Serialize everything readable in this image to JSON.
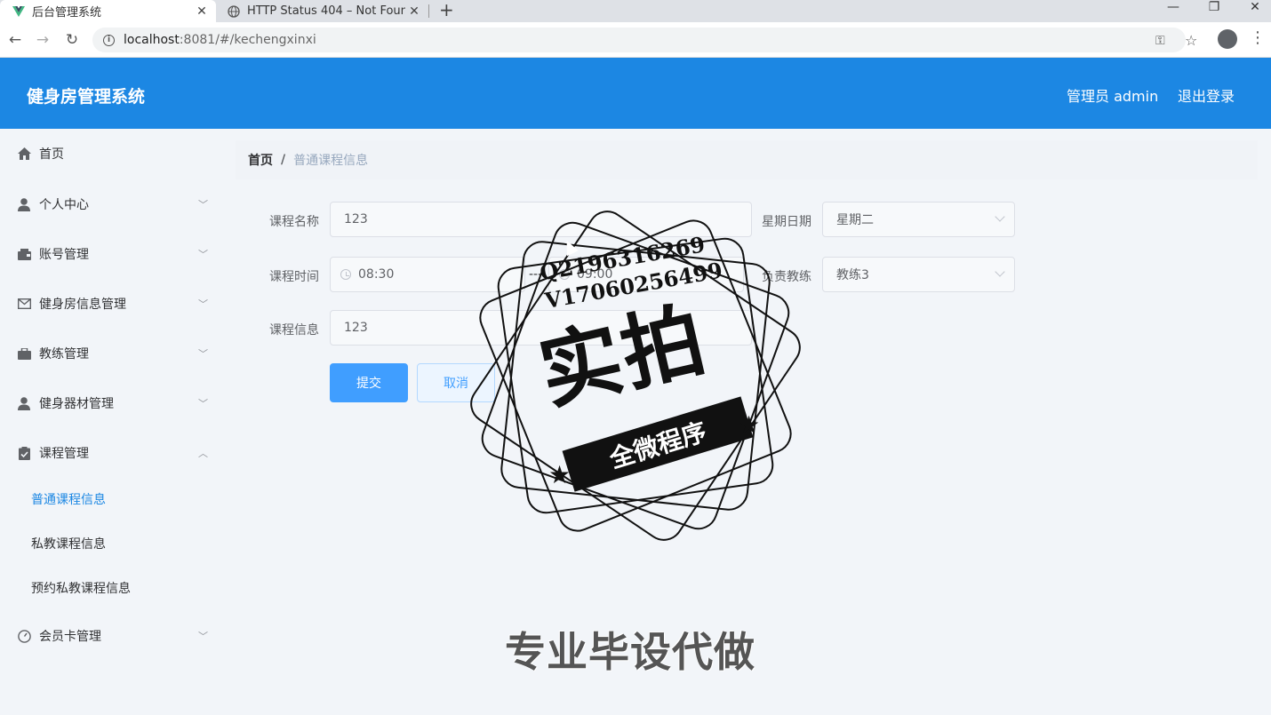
{
  "browser": {
    "tabs": [
      {
        "title": "后台管理系统",
        "active": true,
        "icon": "vue-logo-icon"
      },
      {
        "title": "HTTP Status 404 – Not Found",
        "active": false,
        "icon": "globe-icon"
      }
    ],
    "url_host": "localhost",
    "url_path": ":8081/#/kechengxinxi"
  },
  "header": {
    "title": "健身房管理系统",
    "admin_label": "管理员 admin",
    "logout_label": "退出登录",
    "color": "#1c87e3"
  },
  "sidebar": {
    "items": [
      {
        "label": "首页",
        "icon": "home-icon",
        "expandable": false
      },
      {
        "label": "个人中心",
        "icon": "user-icon",
        "expandable": true
      },
      {
        "label": "账号管理",
        "icon": "wallet-icon",
        "expandable": true
      },
      {
        "label": "健身房信息管理",
        "icon": "mail-icon",
        "expandable": true
      },
      {
        "label": "教练管理",
        "icon": "briefcase-icon",
        "expandable": true
      },
      {
        "label": "健身器材管理",
        "icon": "user-icon",
        "expandable": true
      },
      {
        "label": "课程管理",
        "icon": "clipboard-icon",
        "expandable": true,
        "expanded": true
      },
      {
        "label": "会员卡管理",
        "icon": "gauge-icon",
        "expandable": true
      }
    ],
    "sub_items": [
      {
        "label": "普通课程信息",
        "active": true
      },
      {
        "label": "私教课程信息",
        "active": false
      },
      {
        "label": "预约私教课程信息",
        "active": false
      }
    ]
  },
  "breadcrumb": {
    "home": "首页",
    "separator": "/",
    "current": "普通课程信息"
  },
  "form": {
    "course_name_label": "课程名称",
    "course_name_value": "123",
    "weekday_label": "星期日期",
    "weekday_value": "星期二",
    "course_time_label": "课程时间",
    "time_start": "08:30",
    "time_separator": "---",
    "time_end": "09:00",
    "coach_label": "负责教练",
    "coach_value": "教练3",
    "course_info_label": "课程信息",
    "course_info_value": "123",
    "submit_label": "提交",
    "cancel_label": "取消"
  },
  "watermark": {
    "line1": "Q2196316269",
    "line2": "V17060256499",
    "big": "实拍",
    "ribbon": "全微程序",
    "slogan": "专业毕设代做"
  }
}
